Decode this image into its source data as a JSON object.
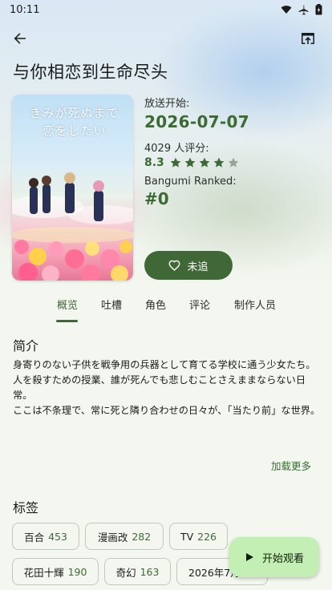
{
  "status_bar": {
    "time": "10:11"
  },
  "header": {
    "title": "与你相恋到生命尽头"
  },
  "cover": {
    "title_text": "きみが死ぬまで恋をしたい"
  },
  "info": {
    "air_start_label": "放送开始:",
    "air_start_date": "2026-07-07",
    "rating_count_label": "4029 人评分:",
    "score": "8.3",
    "stars_filled": 4,
    "stars_total": 5,
    "rank_label": "Bangumi Ranked:",
    "rank_value": "#0"
  },
  "follow_button": {
    "label": "未追"
  },
  "tabs": [
    {
      "label": "概览",
      "active": true
    },
    {
      "label": "吐槽",
      "active": false
    },
    {
      "label": "角色",
      "active": false
    },
    {
      "label": "评论",
      "active": false
    },
    {
      "label": "制作人员",
      "active": false
    }
  ],
  "synopsis": {
    "title": "简介",
    "lines": [
      "身寄りのない子供を戦争用の兵器として育てる学校に通う少女たち。",
      "人を殺すための授業、誰が死んでも悲しむことさえままならない日常。",
      "ここは不条理で、常に死と隣り合わせの日々が、「当たり前」な世界。"
    ],
    "load_more": "加载更多"
  },
  "tags_section": {
    "title": "标签",
    "tags": [
      {
        "name": "百合",
        "count": "453"
      },
      {
        "name": "漫画改",
        "count": "282"
      },
      {
        "name": "TV",
        "count": "226"
      },
      {
        "name": "花田十輝",
        "count": "190"
      },
      {
        "name": "奇幻",
        "count": "163"
      },
      {
        "name": "2026年7月",
        "count": ""
      }
    ]
  },
  "fab": {
    "label": "开始观看"
  },
  "colors": {
    "accent": "#3c6a35",
    "button_bg": "#406836",
    "fab_bg": "#c4efb4",
    "background": "#f3f7ef"
  }
}
